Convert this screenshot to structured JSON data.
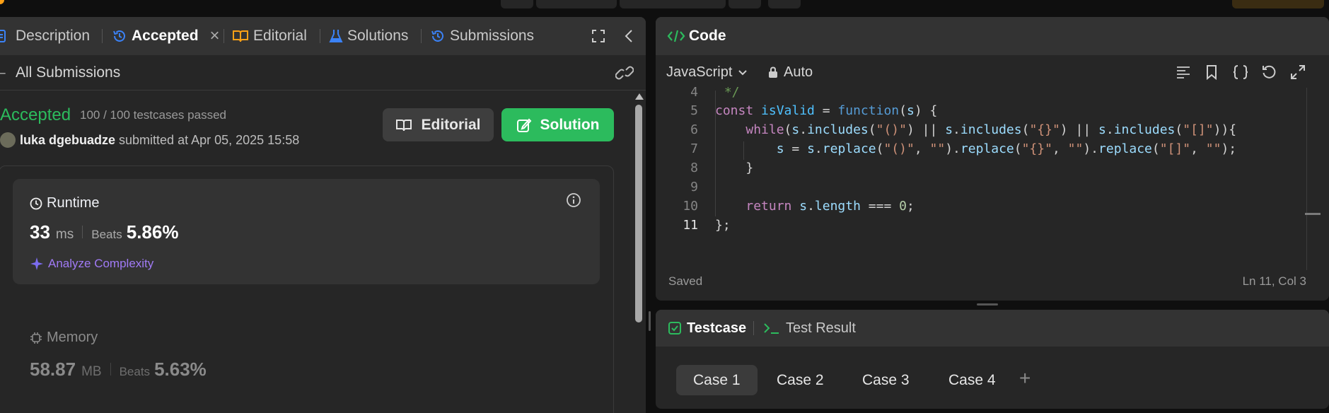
{
  "colors": {
    "accent_green": "#2cbb5d",
    "accent_blue": "#3b82f6",
    "purple": "#a78bfa",
    "panel_bg": "#262626",
    "header_bg": "#333333"
  },
  "left_tabs": [
    {
      "label": "Description",
      "icon": "description-icon"
    },
    {
      "label": "Accepted",
      "icon": "history-icon",
      "closable": true
    },
    {
      "label": "Editorial",
      "icon": "book-icon"
    },
    {
      "label": "Solutions",
      "icon": "flask-icon"
    },
    {
      "label": "Submissions",
      "icon": "history-icon"
    }
  ],
  "submission": {
    "back_label": "All Submissions",
    "status": "Accepted",
    "testcases": "100 / 100 testcases passed",
    "user": "luka dgebuadze",
    "submitted_text": "submitted at Apr 05, 2025 15:58",
    "editorial_btn": "Editorial",
    "solution_btn": "Solution"
  },
  "runtime": {
    "title": "Runtime",
    "value": "33",
    "unit": "ms",
    "beats_label": "Beats",
    "beats": "5.86%",
    "analyze": "Analyze Complexity"
  },
  "memory": {
    "title": "Memory",
    "value": "58.87",
    "unit": "MB",
    "beats_label": "Beats",
    "beats": "5.63%"
  },
  "code": {
    "title": "Code",
    "language": "JavaScript",
    "mode": "Auto",
    "status": "Saved",
    "cursor": "Ln 11, Col 3",
    "line_numbers": [
      "4",
      "5",
      "6",
      "7",
      "8",
      "9",
      "10",
      "11"
    ],
    "lines": [
      " */",
      "const isValid = function(s) {",
      "    while(s.includes(\"()\") || s.includes(\"{}\") || s.includes(\"[]\")){",
      "        s = s.replace(\"()\", \"\").replace(\"{}\", \"\").replace(\"[]\", \"\");",
      "    }",
      "",
      "    return s.length === 0;",
      "};"
    ]
  },
  "test": {
    "tab_testcase": "Testcase",
    "tab_result": "Test Result",
    "cases": [
      "Case 1",
      "Case 2",
      "Case 3",
      "Case 4"
    ],
    "add": "+"
  }
}
